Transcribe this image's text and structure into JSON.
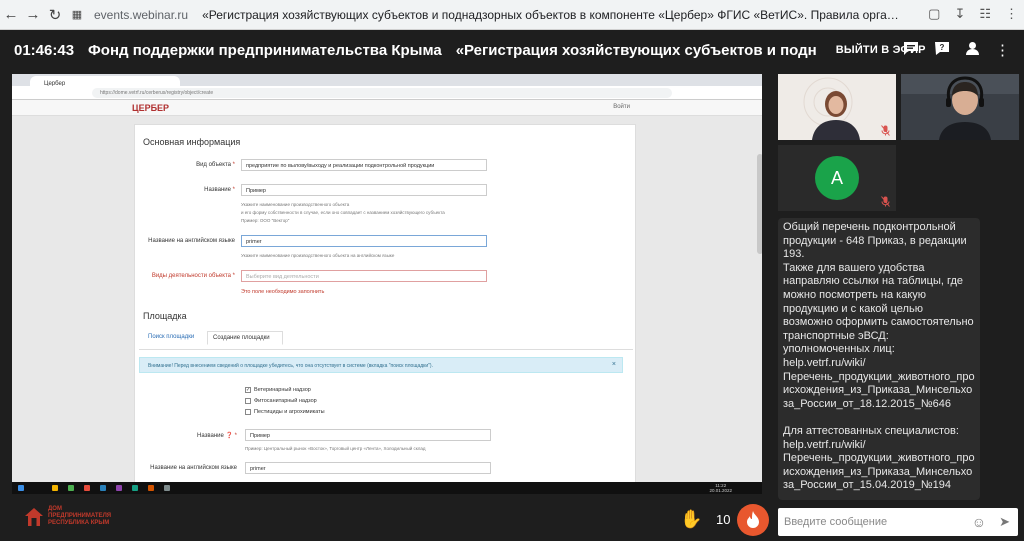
{
  "browser": {
    "url": "events.webinar.ru",
    "page_title": "«Регистрация хозяйствующих субъектов и поднадзорных объектов в компоненте «Цербер» ФГИС «ВетИС». Правила организации работы..."
  },
  "webinar_header": {
    "time": "01:46:43",
    "organization": "Фонд поддержки предпринимательства Крыма",
    "title": "«Регистрация хозяйствующих субъектов и поднадзор",
    "go_live_label": "ВЫЙТИ В ЭФИР"
  },
  "shared_screen": {
    "tab_title": "Цербер",
    "address": "https://dome.vetrf.ru/cerberus/registry/object/create",
    "app_logo": "ЦЕРБЕР",
    "login_link": "Войти",
    "section_main": "Основная информация",
    "object_type_label": "Вид объекта",
    "object_type_value": "предприятие по вылову/выходу и реализации подконтрольной продукции",
    "name_label": "Название",
    "name_value": "Пример",
    "name_hint_1": "Укажите наименование производственного объекта",
    "name_hint_2": "и его форму собственности в случае, если оно совпадает с названием хозяйствующего субъекта",
    "name_hint_3": "Пример: ООО \"Вектор\"",
    "eng_name_label": "Название на английском языке",
    "eng_name_value": "primer",
    "eng_name_hint": "Укажите наименование производственного объекта на английском языке",
    "activity_label": "Виды деятельности объекта",
    "activity_placeholder": "Выберите вид деятельности",
    "activity_error": "Это поле необходимо заполнить",
    "section_site": "Площадка",
    "tab_search": "Поиск площадки",
    "tab_create": "Создание площадки",
    "alert_text": "Внимание! Перед внесением сведений о площадке убедитесь, что она отсутствует в системе (вкладка \"поиск площадки\").",
    "checkbox_vet": "Ветеринарный надзор",
    "checkbox_phyto": "Фитосанитарный надзор",
    "checkbox_pest": "Пестициды и агрохимикаты",
    "site_name_label": "Название",
    "site_name_value": "Пример",
    "site_name_hint": "Пример: Центральный рынок «Восток», Торговый центр «Лента», Холодильный склад",
    "site_eng_label": "Название на английском языке",
    "site_eng_value": "primer",
    "clock_time": "11:22",
    "clock_date": "20.01.2022"
  },
  "participants": {
    "third_initial": "A"
  },
  "chat": {
    "message_1": "Общий перечень подконтрольной продукции - 648 Приказ, в редакции 193.\nТакже для вашего удобства направляю ссылки на таблицы, где можно посмотреть на какую продукцию и с какой целью возможно оформить самостоятельно транспортные эВСД:\nуполномоченных лиц:\nhelp.vetrf.ru/wiki/\nПеречень_продукции_животного_происхождения_из_Приказа_Минсельхоза_России_от_18.12.2015_№646",
    "message_2": "Для аттестованных специалистов:\nhelp.vetrf.ru/wiki/\nПеречень_продукции_животного_происхождения_из_Приказа_Минсельхоза_России_от_15.04.2019_№194"
  },
  "bottom_bar": {
    "logo_line1": "ДОМ",
    "logo_line2": "ПРЕДПРИНИМАТЕЛЯ",
    "logo_line3": "РЕСПУБЛИКА КРЫМ",
    "raised_hands": "10",
    "message_placeholder": "Введите сообщение"
  },
  "colors": {
    "accent_fire": "#e8572e",
    "avatar_green": "#1aa34a",
    "brand_red": "#c0392b"
  }
}
